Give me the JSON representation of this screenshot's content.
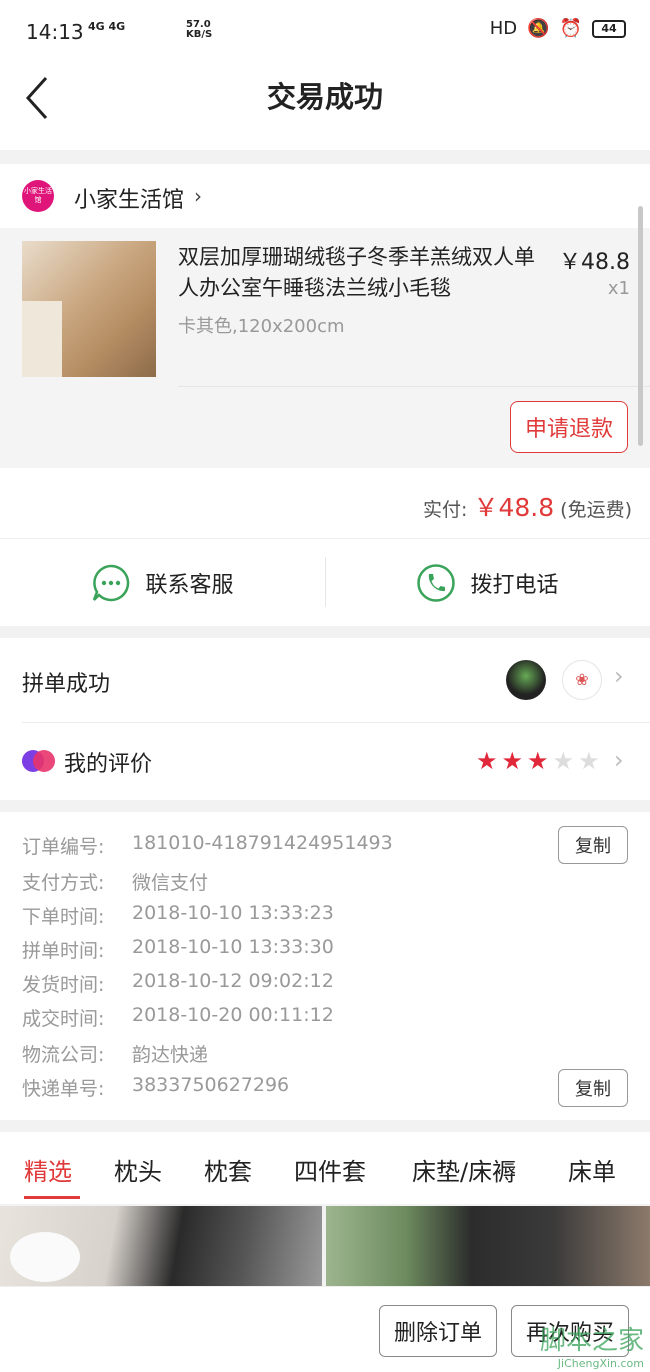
{
  "status_bar": {
    "time": "14:13",
    "network": "4G 4G",
    "speed_value": "57.0",
    "speed_unit": "KB/S",
    "hd": "HD",
    "battery": "44"
  },
  "header": {
    "title": "交易成功"
  },
  "shop": {
    "logo_text": "小家生活馆",
    "name": "小家生活馆"
  },
  "product": {
    "title": "双层加厚珊瑚绒毯子冬季羊羔绒双人单人办公室午睡毯法兰绒小毛毯",
    "spec": "卡其色,120x200cm",
    "price": "￥48.8",
    "qty": "x1",
    "refund_label": "申请退款"
  },
  "payment": {
    "label": "实付:",
    "amount": "￥48.8",
    "note": "(免运费)"
  },
  "contact": {
    "service_label": "联系客服",
    "phone_label": "拨打电话"
  },
  "group": {
    "label": "拼单成功",
    "avatar2_glyph": "❀"
  },
  "review": {
    "label": "我的评价",
    "stars": 3,
    "max_stars": 5
  },
  "order_info": {
    "copy_label": "复制",
    "rows": [
      {
        "key": "订单编号:",
        "value": "181010-418791424951493"
      },
      {
        "key": "支付方式:",
        "value": "微信支付"
      },
      {
        "key": "下单时间:",
        "value": "2018-10-10 13:33:23"
      },
      {
        "key": "拼单时间:",
        "value": "2018-10-10 13:33:30"
      },
      {
        "key": "发货时间:",
        "value": "2018-10-12 09:02:12"
      },
      {
        "key": "成交时间:",
        "value": "2018-10-20 00:11:12"
      },
      {
        "key": "物流公司:",
        "value": "韵达快递"
      },
      {
        "key": "快递单号:",
        "value": "3833750627296"
      }
    ]
  },
  "tabs": [
    "精选",
    "枕头",
    "枕套",
    "四件套",
    "床垫/床褥",
    "床单"
  ],
  "bottom_bar": {
    "delete_label": "删除订单",
    "rebuy_label": "再次购买"
  },
  "watermark": {
    "text": "脚本之家",
    "url": "JiChengXin.com"
  },
  "colors": {
    "accent": "#e03a3a",
    "green": "#3aa35a",
    "logo": "#e0157a"
  }
}
